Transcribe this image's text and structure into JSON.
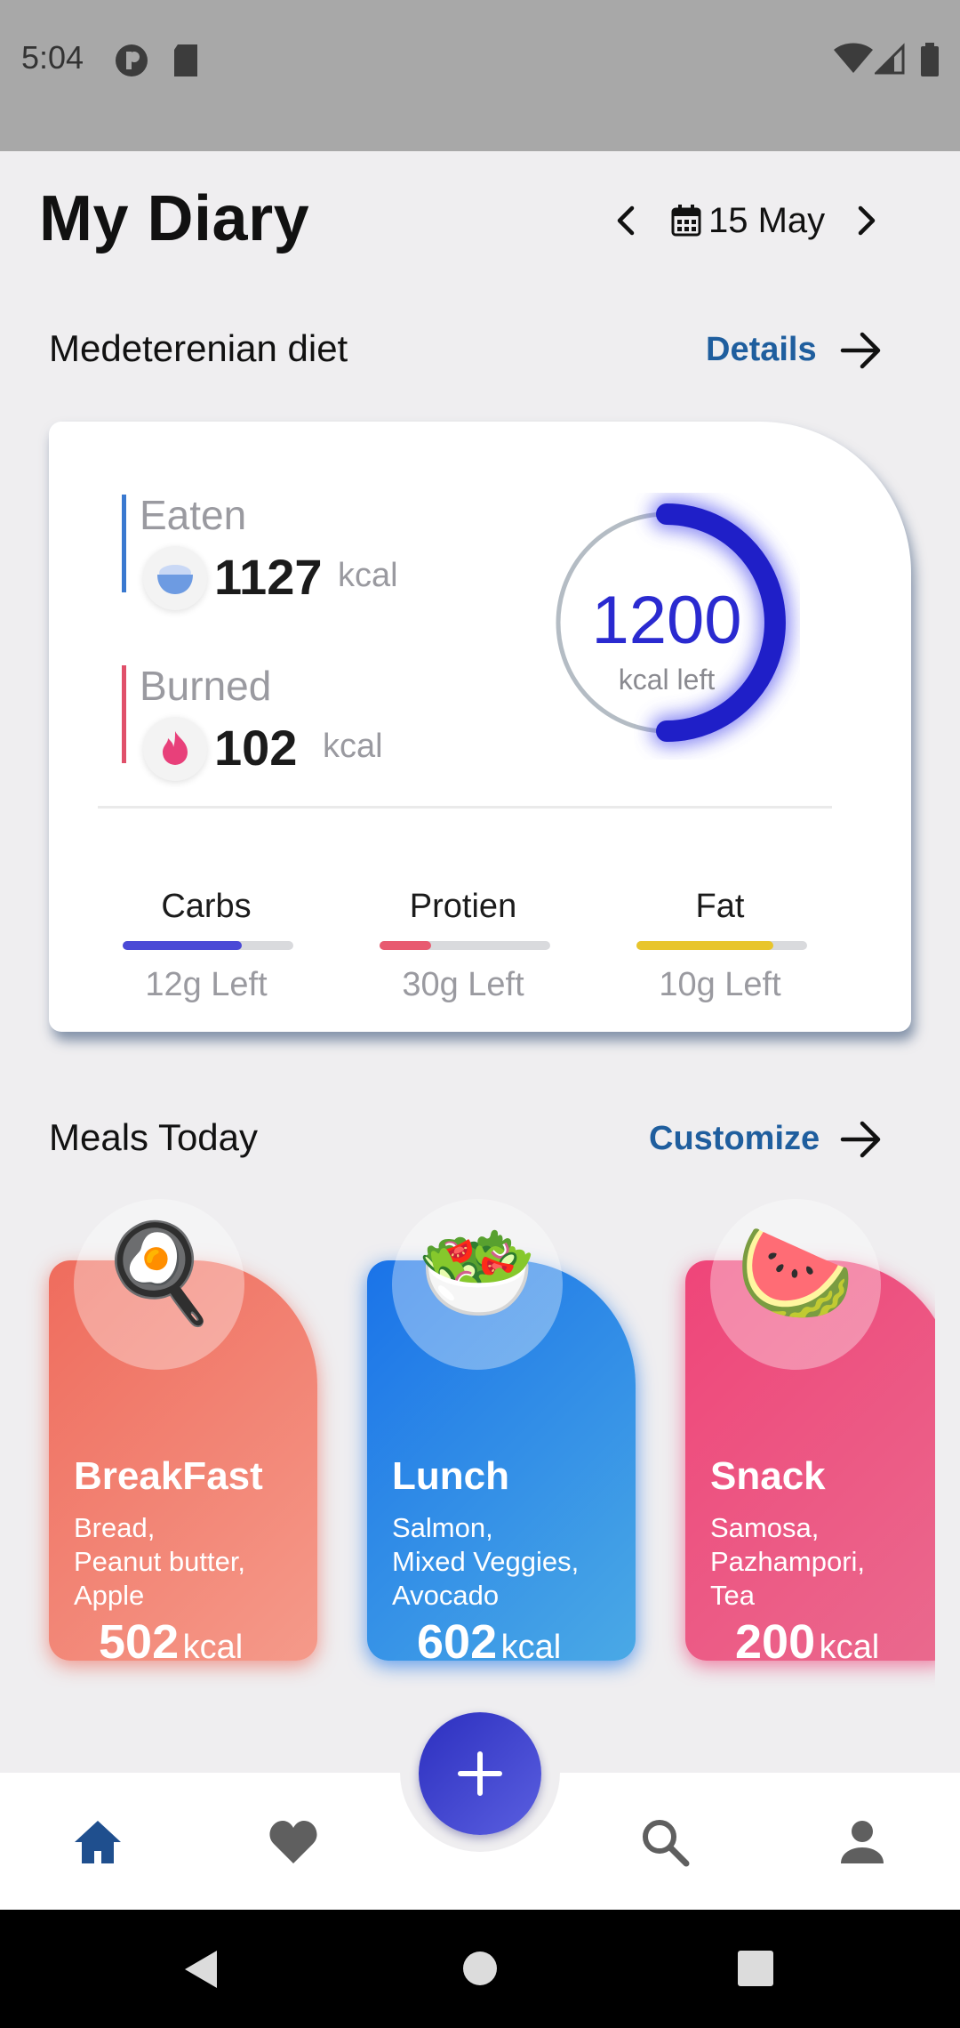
{
  "status_bar": {
    "time": "5:04"
  },
  "header": {
    "title": "My Diary",
    "date": "15 May"
  },
  "diet_section": {
    "title": "Medeterenian diet",
    "link_label": "Details"
  },
  "summary": {
    "eaten_label": "Eaten",
    "eaten_value": "1127",
    "eaten_unit": "kcal",
    "burned_label": "Burned",
    "burned_value": "102",
    "burned_unit": "kcal",
    "ring_value": "1200",
    "ring_caption": "kcal left",
    "ring_fraction": 0.5,
    "colors": {
      "eaten": "#3a79d0",
      "burned": "#e0506a",
      "ring": "#1f1fc8"
    },
    "macros": [
      {
        "label": "Carbs",
        "left": "12g Left",
        "fraction": 0.7,
        "color": "#4a49d6"
      },
      {
        "label": "Protien",
        "left": "30g Left",
        "fraction": 0.3,
        "color": "#e85a70"
      },
      {
        "label": "Fat",
        "left": "10g Left",
        "fraction": 0.8,
        "color": "#e8c52c"
      }
    ]
  },
  "meals_section": {
    "title": "Meals Today",
    "link_label": "Customize"
  },
  "meals": [
    {
      "title": "BreakFast",
      "items": [
        "Bread,",
        "Peanut butter,",
        "Apple"
      ],
      "kcal": "502",
      "unit": "kcal",
      "icon": "egg-toast-icon",
      "emoji": "🍳",
      "color_from": "#ef6c5d",
      "color_to": "#f59a8a"
    },
    {
      "title": "Lunch",
      "items": [
        "Salmon,",
        "Mixed Veggies,",
        "Avocado"
      ],
      "kcal": "602",
      "unit": "kcal",
      "icon": "salad-bowl-icon",
      "emoji": "🥗",
      "color_from": "#1a73e8",
      "color_to": "#4aa9e6"
    },
    {
      "title": "Snack",
      "items": [
        "Samosa,",
        "Pazhampori,",
        "Tea"
      ],
      "kcal": "200",
      "unit": "kcal",
      "icon": "watermelon-icon",
      "emoji": "🍉",
      "color_from": "#ef4579",
      "color_to": "#ea6a8e"
    }
  ],
  "bottom_nav": {
    "items": [
      "home-icon",
      "heart-icon",
      "search-icon",
      "profile-icon"
    ],
    "active_color": "#1f4f8e",
    "inactive_color": "#5f5f5f"
  }
}
